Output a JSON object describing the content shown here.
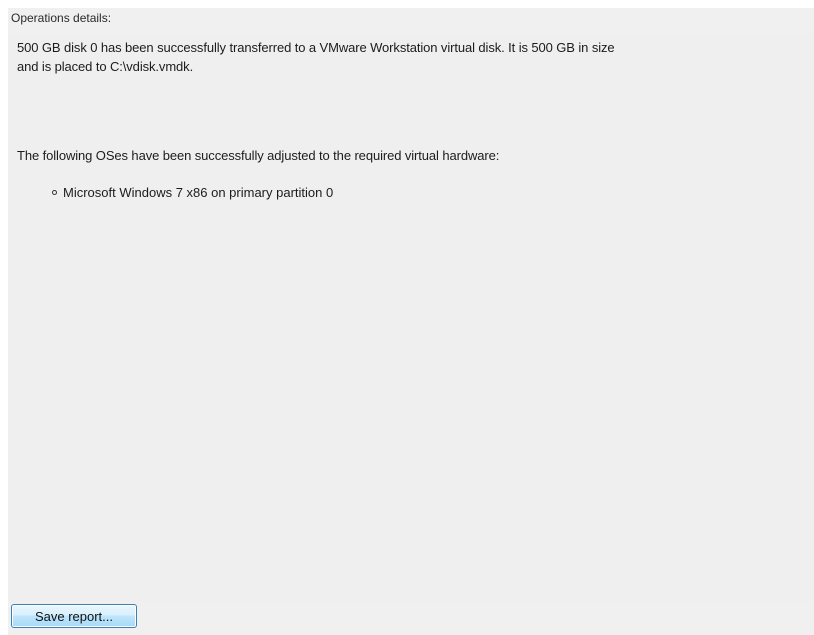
{
  "operations": {
    "label": "Operations details:",
    "transfer_line_1": "500 GB disk 0 has been successfully transferred to a  VMware Workstation virtual disk. It is 500 GB in size",
    "transfer_line_2": "and is placed to C:\\vdisk.vmdk.",
    "adjusted_message": "The following OSes have been successfully adjusted to the required virtual hardware:",
    "os_items": [
      "Microsoft Windows 7 x86 on primary partition 0"
    ]
  },
  "actions": {
    "save_report_label": "Save report..."
  }
}
